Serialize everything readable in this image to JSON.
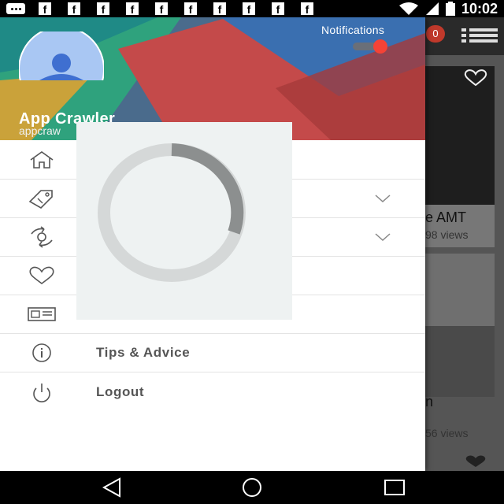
{
  "status_bar": {
    "time": "10:02",
    "notification_icons": [
      "message-icon",
      "facebook-icon",
      "facebook-icon",
      "facebook-icon",
      "facebook-icon",
      "facebook-icon",
      "facebook-icon",
      "facebook-icon",
      "facebook-icon",
      "facebook-icon",
      "facebook-icon"
    ],
    "fb_glyph": "f",
    "system_icons": [
      "wifi-icon",
      "signal-icon",
      "battery-icon"
    ]
  },
  "drawer": {
    "header": {
      "notifications_label": "Notifications",
      "notifications_enabled": true,
      "user_name": "App Crawler",
      "user_email": "appcraw"
    },
    "menu_items": [
      {
        "icon": "home-icon",
        "label": "",
        "has_chevron": false
      },
      {
        "icon": "tag-icon",
        "label": "",
        "has_chevron": true
      },
      {
        "icon": "exchange-icon",
        "label": "",
        "has_chevron": true
      },
      {
        "icon": "heart-icon",
        "label": "",
        "has_chevron": false
      },
      {
        "icon": "news-icon",
        "label": "",
        "has_chevron": false
      },
      {
        "icon": "info-icon",
        "label": "Tips & Advice",
        "has_chevron": false
      },
      {
        "icon": "power-icon",
        "label": "Logout",
        "has_chevron": false
      }
    ]
  },
  "loading": {
    "visible": true
  },
  "background": {
    "badge_count": "0",
    "card1_title": "e AMT",
    "card1_views": "98 views",
    "card2_title": "n",
    "card2_views": "56 views"
  },
  "nav_bar": {
    "buttons": [
      "back-icon",
      "home-circle-icon",
      "recents-icon"
    ]
  },
  "colors": {
    "toggle_on": "#f44336",
    "menu_text": "#555555",
    "divider": "#e4e4e4",
    "spinner_track": "#d5d8d8",
    "spinner_arc": "#8c8f8f"
  }
}
